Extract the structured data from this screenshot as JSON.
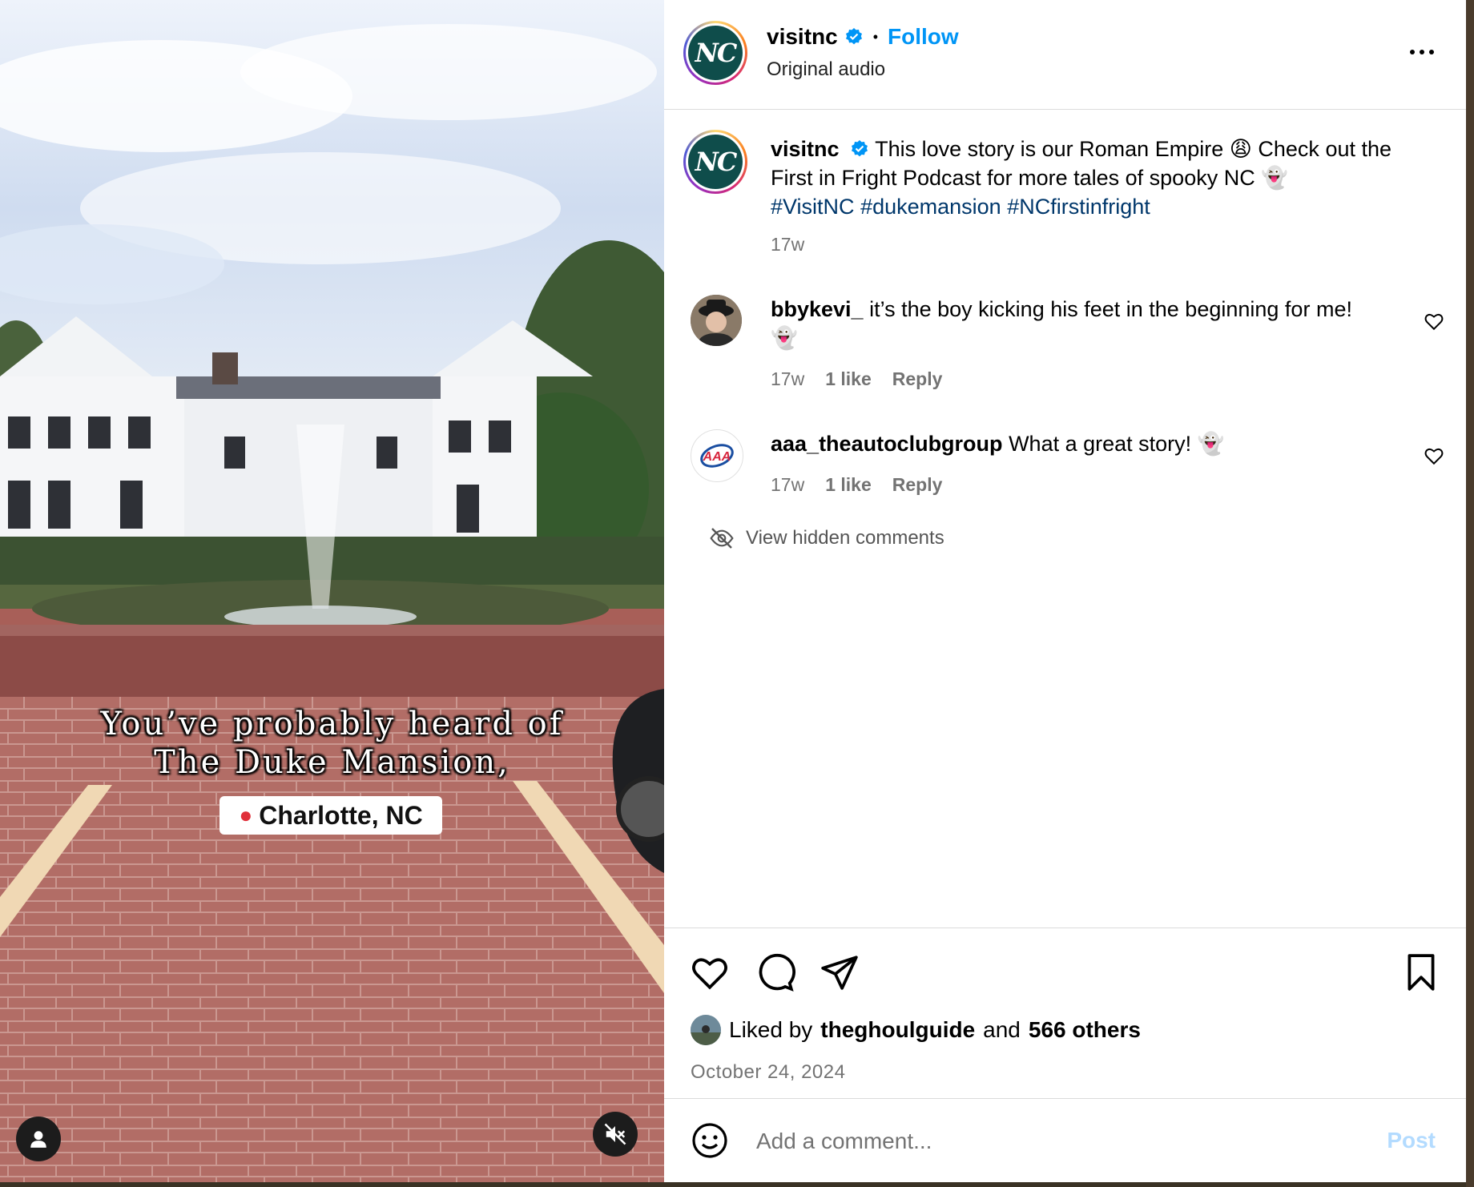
{
  "media": {
    "overlay_line1": "You’ve probably heard of",
    "overlay_line2": "The Duke Mansion,",
    "location_tag": "Charlotte, NC"
  },
  "header": {
    "username": "visitnc",
    "separator": "•",
    "follow_label": "Follow",
    "audio_label": "Original audio",
    "avatar_text": "NC"
  },
  "post": {
    "username": "visitnc",
    "caption_part1": "This love story is our Roman Empire",
    "caption_part2": "Check out the First in Fright Podcast for more tales of spooky NC",
    "hashtags": [
      "#VisitNC",
      "#dukemansion",
      "#NCfirstinfright"
    ],
    "time": "17w",
    "emoji_weary": "😩",
    "emoji_ghost": "👻"
  },
  "comments": [
    {
      "username": "bbykevi_",
      "text_part1": "it’s the boy kicking his feet in the beginning for",
      "text_part2": "me!",
      "emoji": "👻",
      "time": "17w",
      "likes": "1 like",
      "reply": "Reply"
    },
    {
      "username": "aaa_theautoclubgroup",
      "text": "What a great story!",
      "emoji": "👻",
      "time": "17w",
      "likes": "1 like",
      "reply": "Reply",
      "avatar_text": "AAA"
    }
  ],
  "hidden_comments_label": "View hidden comments",
  "engagement": {
    "liked_by_prefix": "Liked by",
    "liked_by_user": "theghoulguide",
    "and_word": "and",
    "others": "566 others",
    "date": "October 24, 2024"
  },
  "add_comment": {
    "placeholder": "Add a comment...",
    "post_label": "Post"
  },
  "colors": {
    "accent": "#0095f6",
    "hashtag": "#00376b",
    "brand_teal": "#0f4d4b",
    "muted": "#737373"
  },
  "icons": [
    "person-icon",
    "muted-speaker-icon",
    "more-options-icon",
    "verified-badge-icon",
    "heart-icon",
    "comment-icon",
    "share-icon",
    "bookmark-icon",
    "eye-off-icon",
    "emoji-icon",
    "location-pin-icon"
  ]
}
